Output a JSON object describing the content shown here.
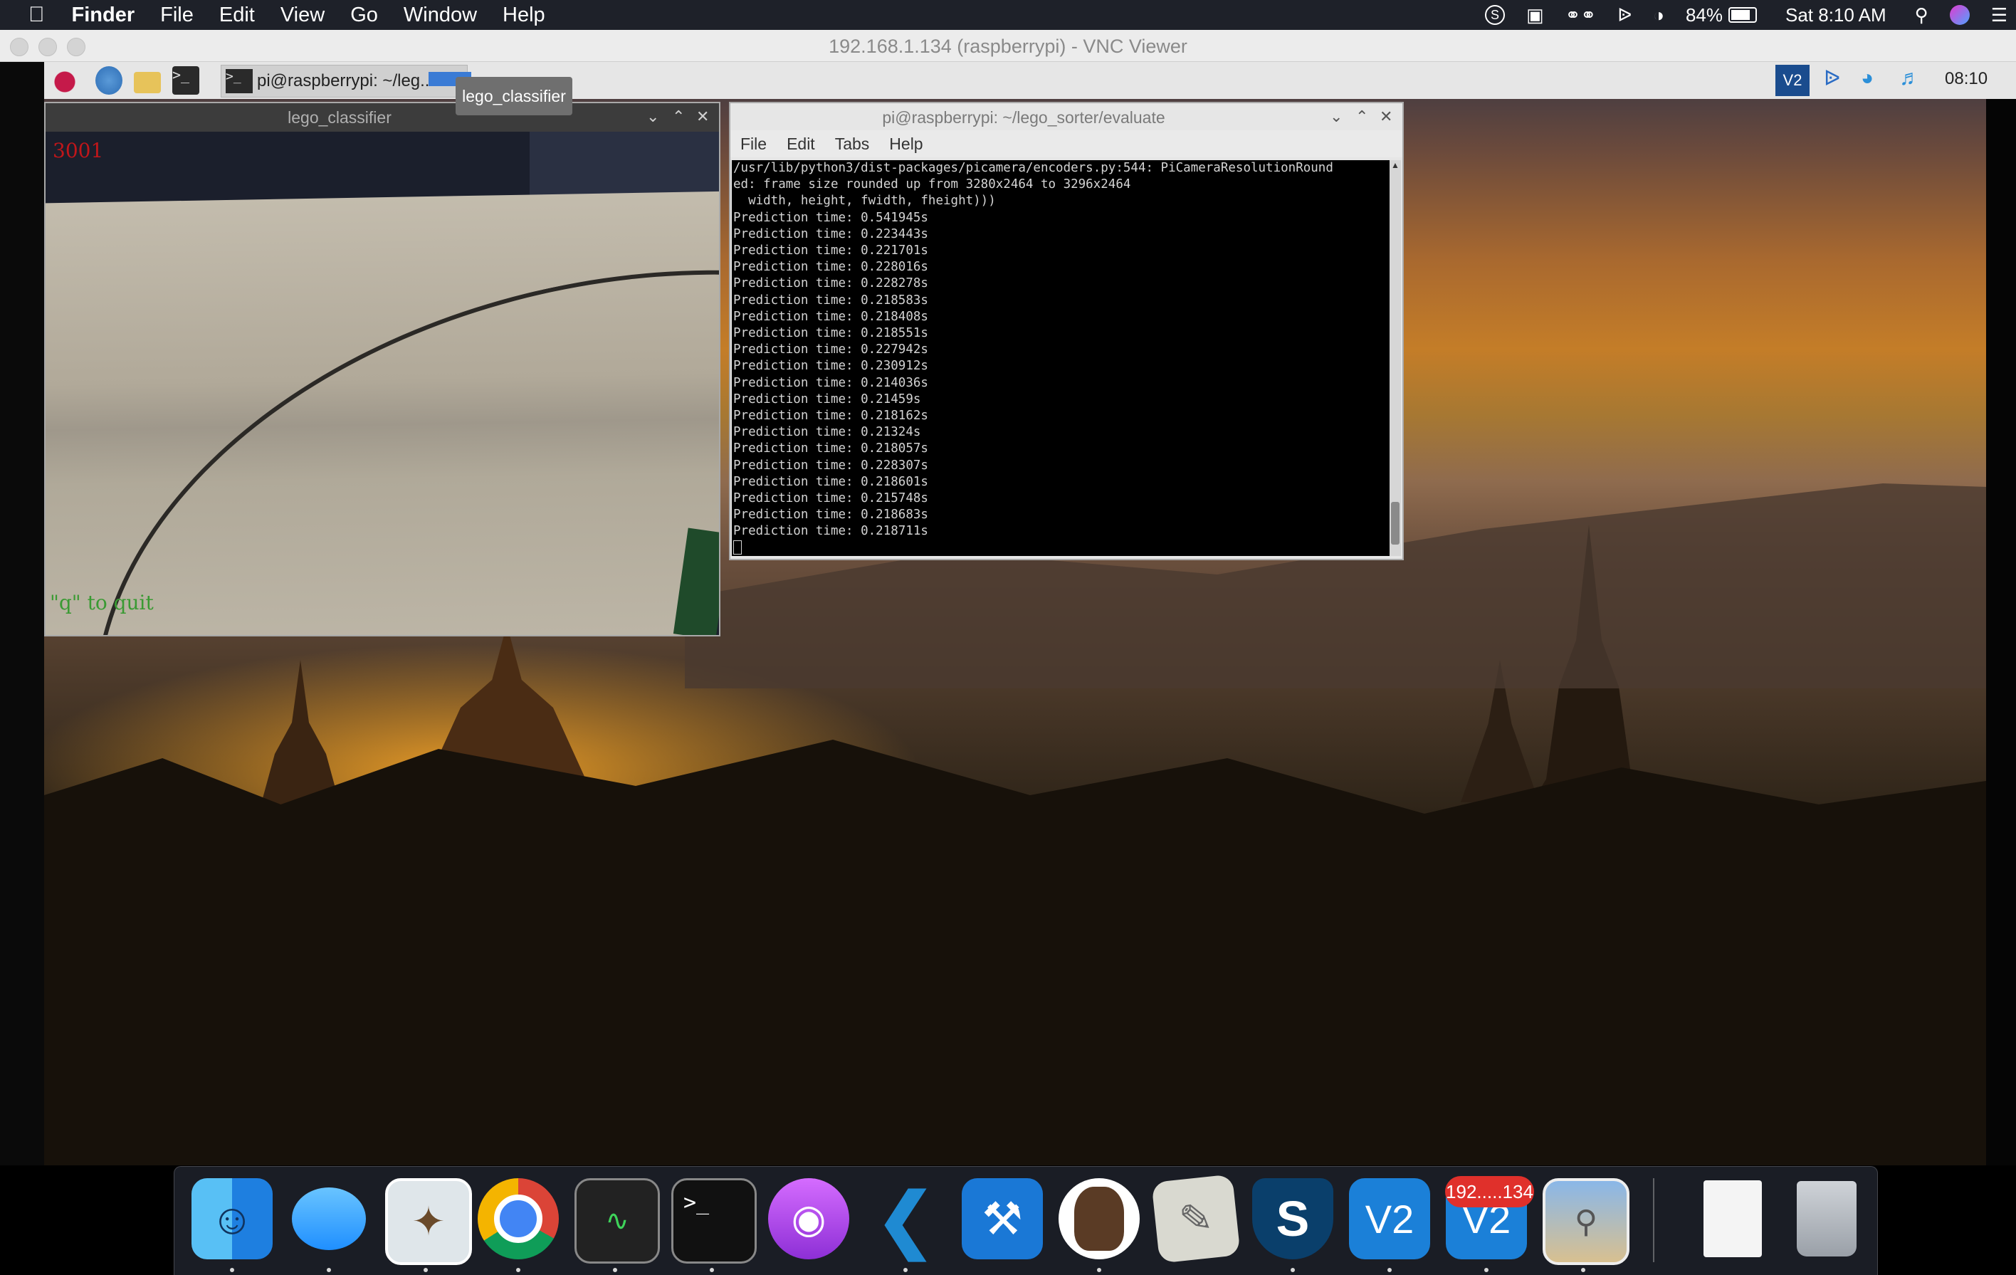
{
  "menubar": {
    "app": "Finder",
    "menus": [
      "File",
      "Edit",
      "View",
      "Go",
      "Window",
      "Help"
    ],
    "battery": "84%",
    "clock": "Sat 8:10 AM"
  },
  "vnc": {
    "title": "192.168.1.134 (raspberrypi) - VNC Viewer"
  },
  "pi_taskbar": {
    "task_label": "pi@raspberrypi: ~/leg...",
    "tooltip": "lego_classifier",
    "clock": "08:10"
  },
  "lego_window": {
    "title": "lego_classifier",
    "count": "3001",
    "hint": "\"q\" to quit"
  },
  "terminal": {
    "title": "pi@raspberrypi: ~/lego_sorter/evaluate",
    "menu": [
      "File",
      "Edit",
      "Tabs",
      "Help"
    ],
    "lines": [
      "/usr/lib/python3/dist-packages/picamera/encoders.py:544: PiCameraResolutionRound",
      "ed: frame size rounded up from 3280x2464 to 3296x2464",
      "  width, height, fwidth, fheight)))",
      "Prediction time: 0.541945s",
      "Prediction time: 0.223443s",
      "Prediction time: 0.221701s",
      "Prediction time: 0.228016s",
      "Prediction time: 0.228278s",
      "Prediction time: 0.218583s",
      "Prediction time: 0.218408s",
      "Prediction time: 0.218551s",
      "Prediction time: 0.227942s",
      "Prediction time: 0.230912s",
      "Prediction time: 0.214036s",
      "Prediction time: 0.21459s",
      "Prediction time: 0.218162s",
      "Prediction time: 0.21324s",
      "Prediction time: 0.218057s",
      "Prediction time: 0.228307s",
      "Prediction time: 0.218601s",
      "Prediction time: 0.215748s",
      "Prediction time: 0.218683s",
      "Prediction time: 0.218711s"
    ]
  },
  "dock": {
    "vnc_badge": "192.....134",
    "icons": [
      "finder-icon",
      "messages-icon",
      "mail-icon",
      "chrome-icon",
      "activity-monitor-icon",
      "terminal-icon",
      "podcasts-icon",
      "vscode-icon",
      "xcode-icon",
      "sequel-pro-icon",
      "script-editor-icon",
      "sophos-icon",
      "vnc-viewer-icon",
      "vnc-viewer-session-icon",
      "preview-icon",
      "document-icon",
      "trash-icon"
    ]
  }
}
